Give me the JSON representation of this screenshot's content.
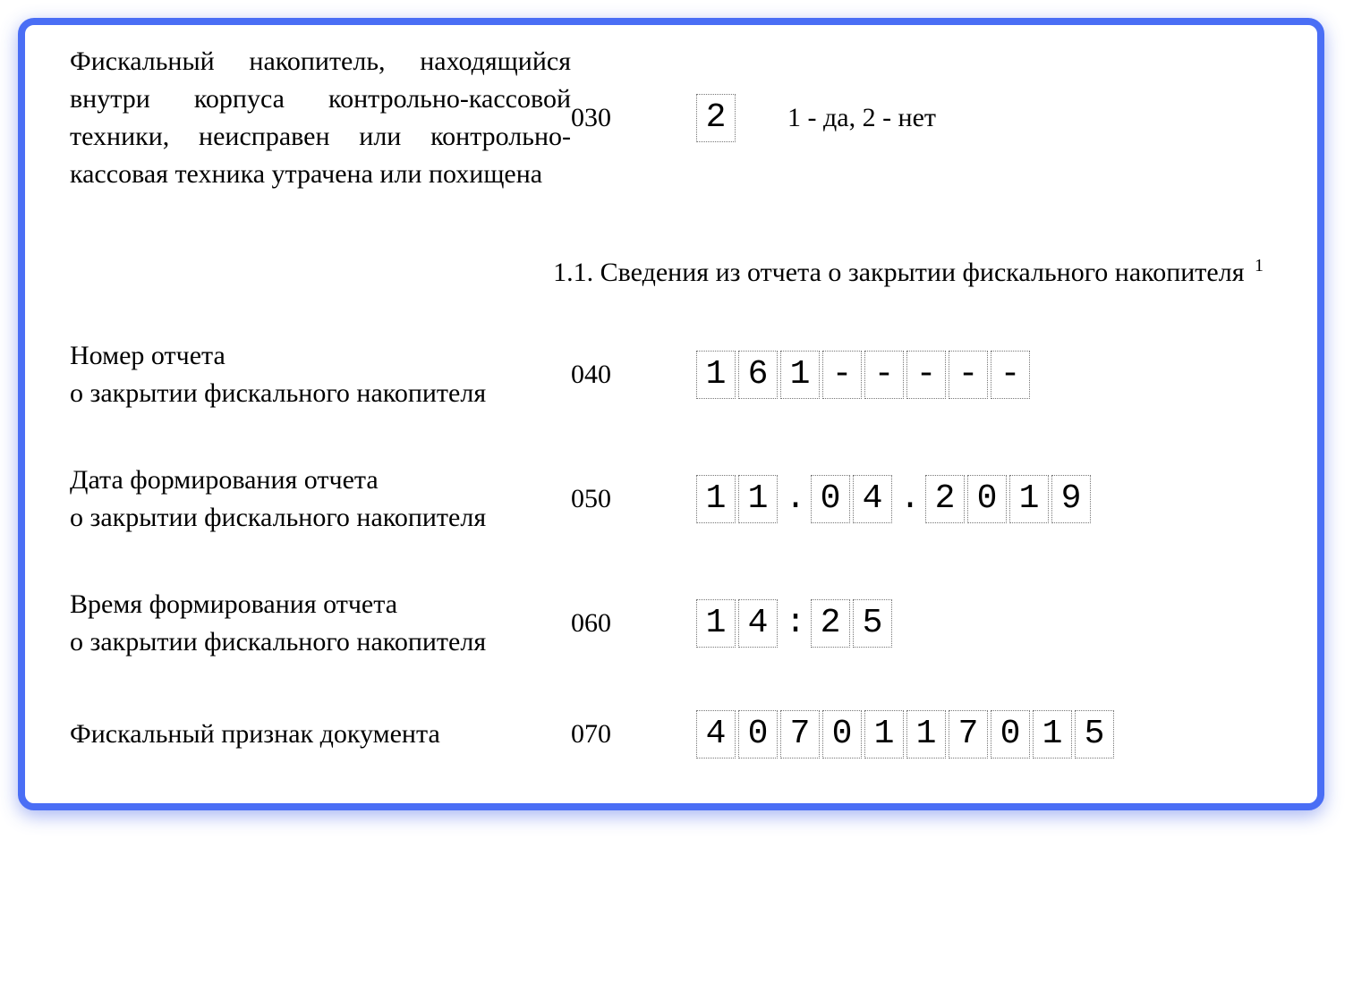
{
  "row030": {
    "label": "Фискальный накопитель, находящийся внутри корпуса контрольно-кассовой техники, неисправен или контрольно-кассовая техника утрачена или похищена",
    "code": "030",
    "cells": [
      "2"
    ],
    "hint": "1 - да,  2 - нет"
  },
  "section_title": "1.1. Сведения из отчета о закрытии фискального накопителя",
  "section_title_sup": "1",
  "row040": {
    "label": "Номер отчета\nо закрытии фискального накопителя",
    "code": "040",
    "cells": [
      "1",
      "6",
      "1",
      "-",
      "-",
      "-",
      "-",
      "-"
    ]
  },
  "row050": {
    "label": "Дата формирования отчета\nо закрытии фискального накопителя",
    "code": "050",
    "d1": "1",
    "d2": "1",
    "sep1": ".",
    "d3": "0",
    "d4": "4",
    "sep2": ".",
    "d5": "2",
    "d6": "0",
    "d7": "1",
    "d8": "9"
  },
  "row060": {
    "label": "Время формирования отчета\nо закрытии фискального накопителя",
    "code": "060",
    "t1": "1",
    "t2": "4",
    "sep": ":",
    "t3": "2",
    "t4": "5"
  },
  "row070": {
    "label": "Фискальный признак документа",
    "code": "070",
    "cells": [
      "4",
      "0",
      "7",
      "0",
      "1",
      "1",
      "7",
      "0",
      "1",
      "5"
    ]
  }
}
